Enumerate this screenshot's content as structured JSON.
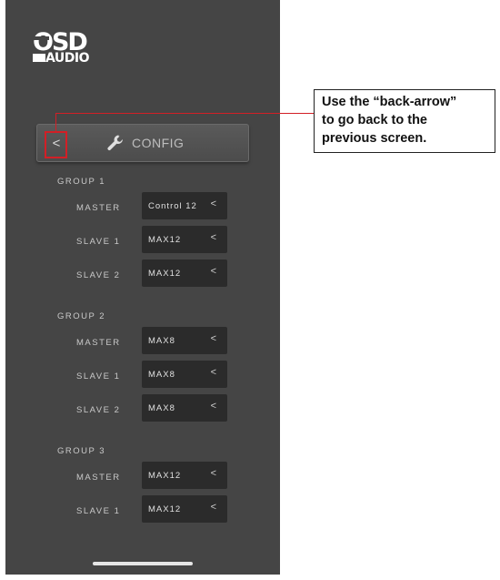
{
  "app": {
    "logo_top": "OSD",
    "logo_bottom": "AUDIO"
  },
  "header": {
    "back_icon": "chevron-left-icon",
    "back_glyph": "<",
    "tool_icon": "wrench-icon",
    "title": "CONFIG"
  },
  "groups": [
    {
      "label": "GROUP 1",
      "rows": [
        {
          "label": "MASTER",
          "value": "Control 12"
        },
        {
          "label": "SLAVE 1",
          "value": "MAX12"
        },
        {
          "label": "SLAVE 2",
          "value": "MAX12"
        }
      ]
    },
    {
      "label": "GROUP 2",
      "rows": [
        {
          "label": "MASTER",
          "value": "MAX8"
        },
        {
          "label": "SLAVE 1",
          "value": "MAX8"
        },
        {
          "label": "SLAVE 2",
          "value": "MAX8"
        }
      ]
    },
    {
      "label": "GROUP 3",
      "rows": [
        {
          "label": "MASTER",
          "value": "MAX12"
        },
        {
          "label": "SLAVE 1",
          "value": "MAX12"
        }
      ]
    }
  ],
  "chevron_glyph": "<",
  "annotation": {
    "line1": "Use the “back-arrow”",
    "line2": "to go back to the",
    "line3": "previous screen.",
    "highlight_color": "#d21f26"
  },
  "colors": {
    "phone_bg": "#454545",
    "select_bg": "#2b2b2b"
  }
}
